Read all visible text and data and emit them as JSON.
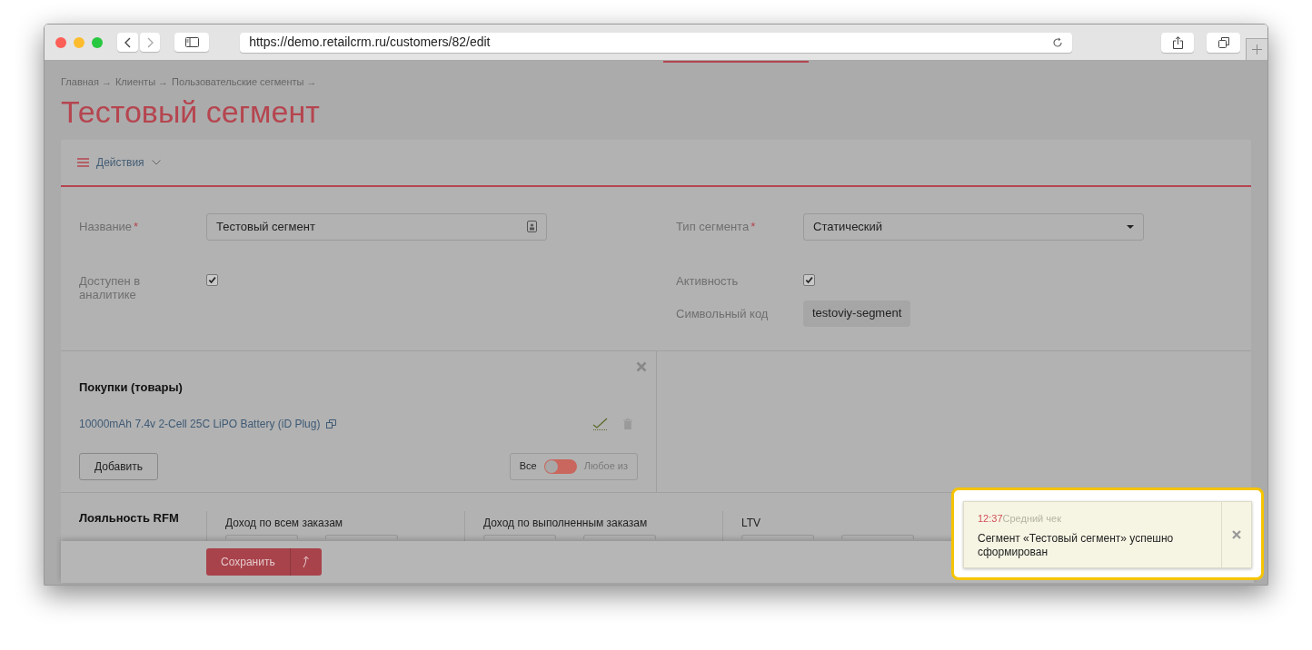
{
  "browser": {
    "url": "https://demo.retailcrm.ru/customers/82/edit"
  },
  "breadcrumbs": [
    "Главная →",
    "Клиенты →",
    "Пользовательские сегменты →"
  ],
  "title": "Тестовый сегмент",
  "actions": {
    "label": "Действия"
  },
  "form": {
    "left": [
      {
        "kind": "text",
        "label": "Название",
        "required_mark": "*",
        "value": "Тестовый сегмент"
      },
      {
        "kind": "checkbox",
        "label": "Доступен в аналитике",
        "checked": true
      }
    ],
    "right": [
      {
        "kind": "select",
        "label": "Тип сегмента",
        "required_mark": "*",
        "value": "Статический"
      },
      {
        "kind": "checkbox",
        "label": "Активность",
        "checked": true
      },
      {
        "kind": "code",
        "label": "Символьный код",
        "value": "testoviy-segment"
      }
    ]
  },
  "purchases": {
    "title": "Покупки (товары)",
    "items": [
      {
        "name": "10000mAh 7.4v 2-Cell 25C LiPO Battery (iD Plug)"
      }
    ],
    "add_button": "Добавить",
    "match": [
      {
        "label": "Все",
        "selected": true
      },
      {
        "label": "Любое из",
        "selected": false
      }
    ]
  },
  "loyalty": {
    "title": "Лояльность RFM",
    "columns": [
      {
        "title": "Доход по всем заказам"
      },
      {
        "title": "Доход по выполненным заказам"
      },
      {
        "title": "LTV"
      },
      {
        "title": "Средний чек"
      }
    ]
  },
  "save_button": "Сохранить",
  "notification": {
    "time": "12:37",
    "message": "Сегмент «Тестовый сегмент» успешно сформирован"
  }
}
